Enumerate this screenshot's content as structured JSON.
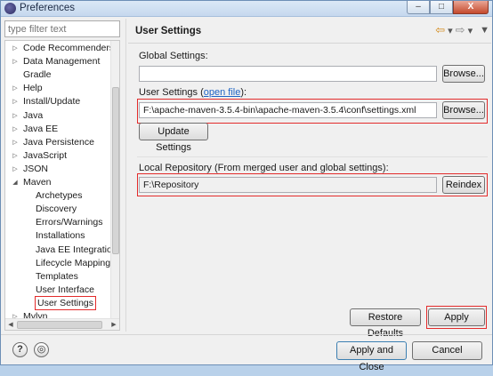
{
  "window": {
    "title": "Preferences",
    "minimize": "–",
    "maximize": "□",
    "close": "X"
  },
  "filter": {
    "placeholder": "type filter text"
  },
  "tree": {
    "items": [
      {
        "label": "Code Recommenders",
        "expander": "▷"
      },
      {
        "label": "Data Management",
        "expander": "▷"
      },
      {
        "label": "Gradle",
        "expander": ""
      },
      {
        "label": "Help",
        "expander": "▷"
      },
      {
        "label": "Install/Update",
        "expander": "▷"
      },
      {
        "label": "Java",
        "expander": "▷"
      },
      {
        "label": "Java EE",
        "expander": "▷"
      },
      {
        "label": "Java Persistence",
        "expander": "▷"
      },
      {
        "label": "JavaScript",
        "expander": "▷"
      },
      {
        "label": "JSON",
        "expander": "▷"
      },
      {
        "label": "Maven",
        "expander": "◢"
      },
      {
        "label": "Archetypes",
        "expander": ""
      },
      {
        "label": "Discovery",
        "expander": ""
      },
      {
        "label": "Errors/Warnings",
        "expander": ""
      },
      {
        "label": "Installations",
        "expander": ""
      },
      {
        "label": "Java EE Integration",
        "expander": ""
      },
      {
        "label": "Lifecycle Mapping",
        "expander": ""
      },
      {
        "label": "Templates",
        "expander": ""
      },
      {
        "label": "User Interface",
        "expander": ""
      },
      {
        "label": "User Settings",
        "expander": "",
        "selected": true
      },
      {
        "label": "Mylyn",
        "expander": "▷"
      }
    ],
    "scroll_left": "◀",
    "scroll_right": "▶"
  },
  "page": {
    "title": "User Settings",
    "nav_back": "⇦",
    "nav_back_menu": "▾",
    "nav_forward": "⇨",
    "nav_forward_menu": "▾",
    "view_menu": "▼"
  },
  "global_settings": {
    "label": "Global Settings:",
    "value": "",
    "browse": "Browse..."
  },
  "user_settings": {
    "label_prefix": "User Settings (",
    "link": "open file",
    "label_suffix": "):",
    "value": "F:\\apache-maven-3.5.4-bin\\apache-maven-3.5.4\\conf\\settings.xml",
    "browse": "Browse...",
    "update": "Update Settings"
  },
  "local_repository": {
    "label": "Local Repository (From merged user and global settings):",
    "value": "F:\\Repository",
    "reindex": "Reindex"
  },
  "buttons": {
    "restore_defaults": "Restore Defaults",
    "apply": "Apply",
    "apply_and_close": "Apply and Close",
    "cancel": "Cancel",
    "help": "?",
    "import": "◎"
  },
  "colors": {
    "highlight": "#e32b2b",
    "link": "#1d63c4"
  }
}
